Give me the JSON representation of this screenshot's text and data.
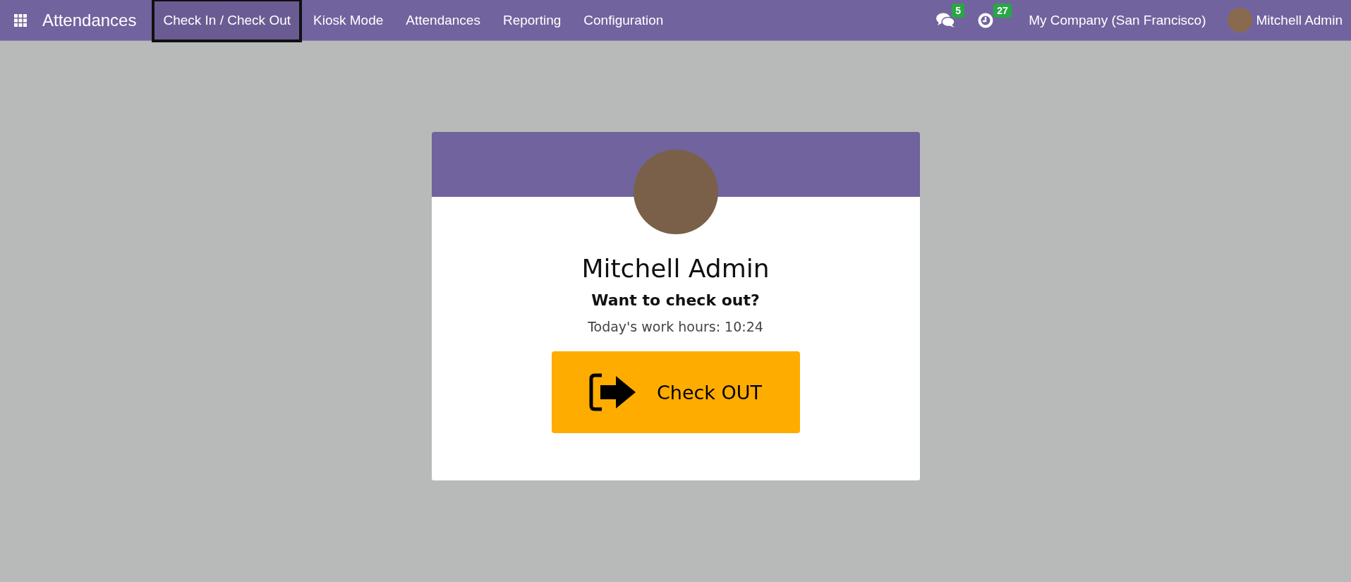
{
  "navbar": {
    "app_name": "Attendances",
    "menu": [
      {
        "label": "Check In / Check Out",
        "selected": true
      },
      {
        "label": "Kiosk Mode",
        "selected": false
      },
      {
        "label": "Attendances",
        "selected": false
      },
      {
        "label": "Reporting",
        "selected": false
      },
      {
        "label": "Configuration",
        "selected": false
      }
    ],
    "messages_count": "5",
    "activities_count": "27",
    "company": "My Company (San Francisco)",
    "user": "Mitchell Admin"
  },
  "card": {
    "employee_name": "Mitchell Admin",
    "question": "Want to check out?",
    "work_hours": "Today's work hours: 10:24",
    "button": "Check OUT"
  }
}
